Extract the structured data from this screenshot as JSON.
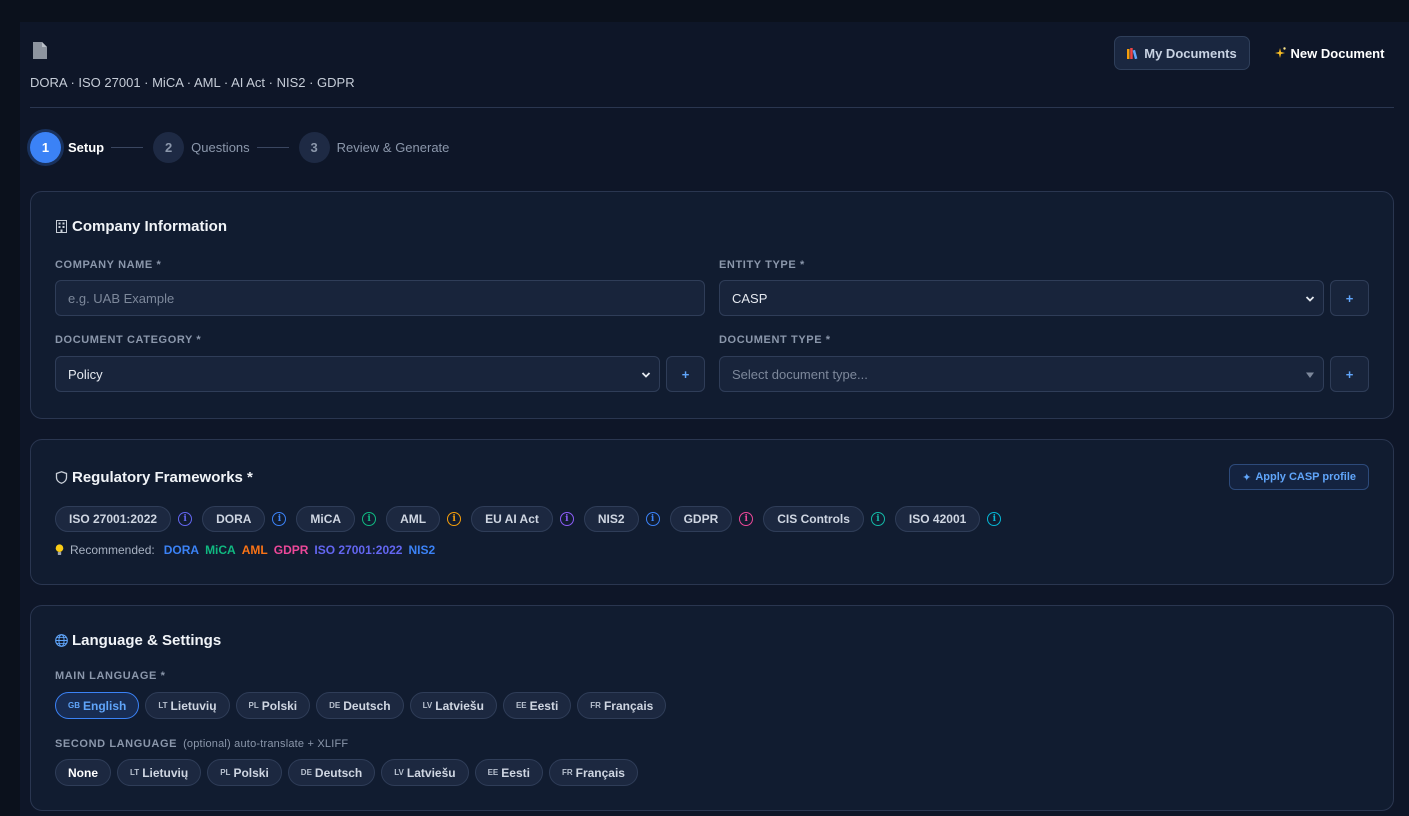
{
  "header": {
    "subtitle": "DORA · ISO 27001 · MiCA · AML · AI Act · NIS2 · GDPR",
    "my_documents_label": "My Documents",
    "new_document_label": "New Document"
  },
  "stepper": {
    "steps": [
      {
        "number": "1",
        "label": "Setup",
        "active": true
      },
      {
        "number": "2",
        "label": "Questions",
        "active": false
      },
      {
        "number": "3",
        "label": "Review & Generate",
        "active": false
      }
    ]
  },
  "company_info": {
    "title": "Company Information",
    "company_name_label": "COMPANY NAME *",
    "company_name_value": "",
    "company_name_placeholder": "e.g. UAB Example",
    "entity_type_label": "ENTITY TYPE *",
    "entity_type_value": "CASP",
    "document_category_label": "DOCUMENT CATEGORY *",
    "document_category_value": "Policy",
    "document_type_label": "DOCUMENT TYPE *",
    "document_type_placeholder": "Select document type...",
    "plus_label": "+"
  },
  "frameworks": {
    "title": "Regulatory Frameworks *",
    "apply_profile_label": "Apply CASP profile",
    "items": [
      {
        "label": "ISO 27001:2022",
        "info_color": "#6366f1"
      },
      {
        "label": "DORA",
        "info_color": "#3b82f6"
      },
      {
        "label": "MiCA",
        "info_color": "#10b981"
      },
      {
        "label": "AML",
        "info_color": "#f59e0b"
      },
      {
        "label": "EU AI Act",
        "info_color": "#8b5cf6"
      },
      {
        "label": "NIS2",
        "info_color": "#3b82f6"
      },
      {
        "label": "GDPR",
        "info_color": "#ec4899"
      },
      {
        "label": "CIS Controls",
        "info_color": "#14b8a6"
      },
      {
        "label": "ISO 42001",
        "info_color": "#06b6d4"
      }
    ],
    "info_glyph": "i",
    "recommended_label": "Recommended:",
    "recommended": [
      {
        "label": "DORA",
        "color": "#3b82f6"
      },
      {
        "label": "MiCA",
        "color": "#10b981"
      },
      {
        "label": "AML",
        "color": "#f97316"
      },
      {
        "label": "GDPR",
        "color": "#ec4899"
      },
      {
        "label": "ISO 27001:2022",
        "color": "#6366f1"
      },
      {
        "label": "NIS2",
        "color": "#3b82f6"
      }
    ]
  },
  "language": {
    "title": "Language & Settings",
    "main_label": "MAIN LANGUAGE *",
    "main_options": [
      {
        "code": "GB",
        "label": "English",
        "selected": true
      },
      {
        "code": "LT",
        "label": "Lietuvių",
        "selected": false
      },
      {
        "code": "PL",
        "label": "Polski",
        "selected": false
      },
      {
        "code": "DE",
        "label": "Deutsch",
        "selected": false
      },
      {
        "code": "LV",
        "label": "Latviešu",
        "selected": false
      },
      {
        "code": "EE",
        "label": "Eesti",
        "selected": false
      },
      {
        "code": "FR",
        "label": "Français",
        "selected": false
      }
    ],
    "second_label": "SECOND LANGUAGE",
    "second_sub": "(optional) auto-translate + XLIFF",
    "second_options": [
      {
        "code": "",
        "label": "None",
        "selected": true
      },
      {
        "code": "LT",
        "label": "Lietuvių",
        "selected": false
      },
      {
        "code": "PL",
        "label": "Polski",
        "selected": false
      },
      {
        "code": "DE",
        "label": "Deutsch",
        "selected": false
      },
      {
        "code": "LV",
        "label": "Latviešu",
        "selected": false
      },
      {
        "code": "EE",
        "label": "Eesti",
        "selected": false
      },
      {
        "code": "FR",
        "label": "Français",
        "selected": false
      }
    ]
  },
  "colors": {
    "accent": "#3b82f6",
    "background": "#0e1628",
    "card": "#111c30"
  }
}
